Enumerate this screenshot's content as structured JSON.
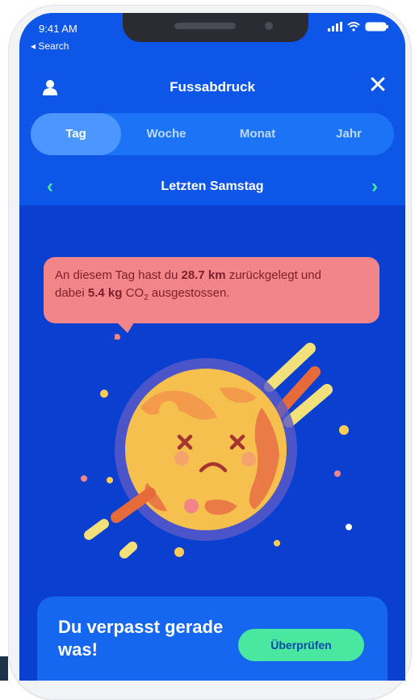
{
  "status": {
    "time": "9:41 AM",
    "back_label": "◂ Search"
  },
  "header": {
    "title": "Fussabdruck"
  },
  "tabs": [
    {
      "label": "Tag",
      "active": true
    },
    {
      "label": "Woche",
      "active": false
    },
    {
      "label": "Monat",
      "active": false
    },
    {
      "label": "Jahr",
      "active": false
    }
  ],
  "date": {
    "label": "Letzten Samstag"
  },
  "bubble": {
    "line1_prefix": "An diesem Tag hast du ",
    "distance": "28.7 km",
    "line1_suffix": " zurückgelegt und",
    "line2_prefix": "dabei ",
    "co2_amount": "5.4 kg",
    "co2_text": " CO",
    "co2_subscript": "2",
    "line2_suffix": " ausgestossen."
  },
  "card": {
    "title": "Du verpasst gerade was!",
    "button_label": "Überprüfen"
  },
  "colors": {
    "header_blue": "#0d56e8",
    "screen_blue": "#0a3fcf",
    "accent_green": "#49e7a0",
    "bubble_pink": "#f2858a"
  },
  "icons": {
    "user": "user-icon",
    "close": "close-icon",
    "prev": "chevron-left-icon",
    "next": "chevron-right-icon"
  }
}
